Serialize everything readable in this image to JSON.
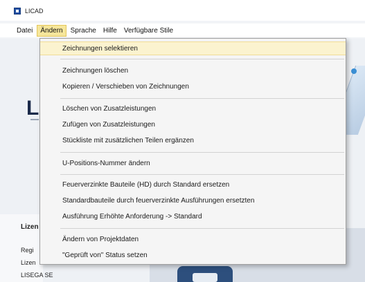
{
  "window": {
    "title": "LICAD"
  },
  "menubar": {
    "items": [
      {
        "label": "Datei"
      },
      {
        "label": "Ändern"
      },
      {
        "label": "Sprache"
      },
      {
        "label": "Hilfe"
      },
      {
        "label": "Verfügbare Stile"
      }
    ],
    "active_index": 1
  },
  "dropdown": {
    "groups": [
      [
        "Zeichnungen selektieren"
      ],
      [
        "Zeichnungen löschen",
        "Kopieren / Verschieben von Zeichnungen"
      ],
      [
        "Löschen von Zusatzleistungen",
        "Zufügen von Zusatzleistungen",
        "Stückliste mit zusätzlichen Teilen ergänzen"
      ],
      [
        "U-Positions-Nummer ändern"
      ],
      [
        "Feuerverzinkte Bauteile (HD) durch Standard ersetzen",
        "Standardbauteile durch feuerverzinkte Ausführungen ersetzten",
        "Ausführung Erhöhte Anforderung -> Standard"
      ],
      [
        "Ändern von Projektdaten",
        "\"Geprüft von\" Status setzen"
      ]
    ],
    "highlighted_item": "Zeichnungen selektieren"
  },
  "background": {
    "logo_letter": "L",
    "panel_heading": "Lizen",
    "panel_lines": [
      "Regi",
      "Lizen",
      "LISEGA SE"
    ]
  },
  "colors": {
    "menu_active": "#f6e69b",
    "highlight": "#fbf3cf",
    "brand_blue": "#1f4fa3"
  },
  "icons": {
    "app": "licad-app-icon"
  }
}
